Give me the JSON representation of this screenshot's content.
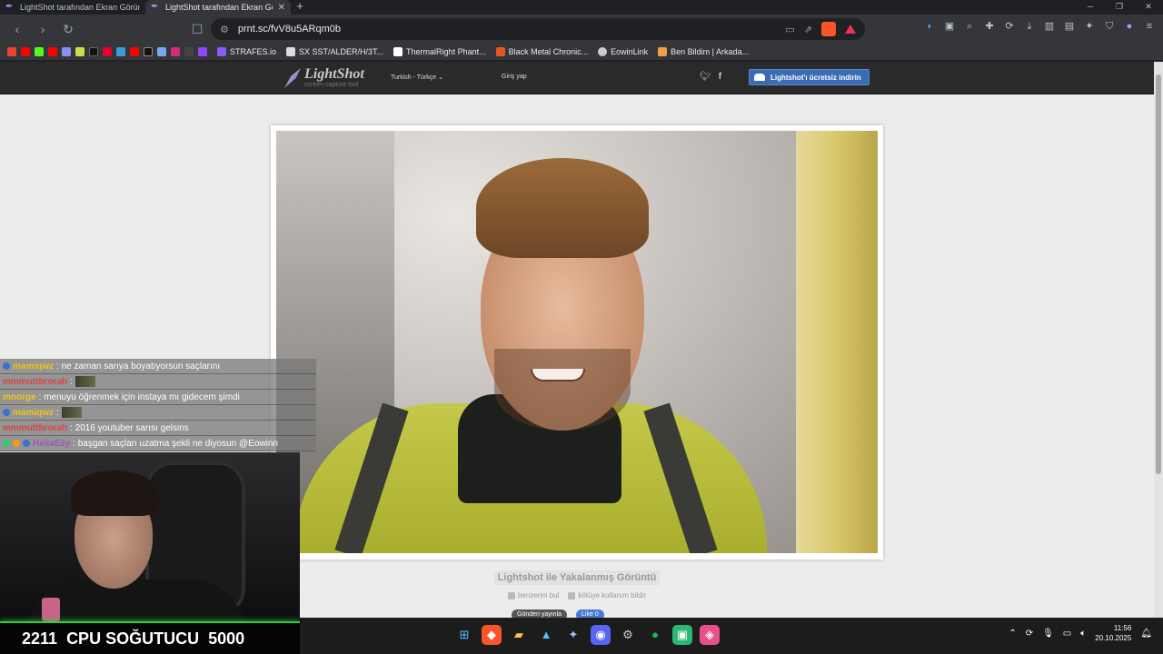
{
  "browser": {
    "tabs": [
      {
        "title": "LightShot tarafından Ekran Görüntü",
        "active": false
      },
      {
        "title": "LightShot tarafından Ekran Görün",
        "active": true
      }
    ],
    "new_tab": "+",
    "url": "prnt.sc/fvV8u5ARqm0b",
    "bookmarks": [
      {
        "label": "STRAFES.io",
        "color": "#8a5cf6"
      },
      {
        "label": "SX SST/ALDER/H/3T...",
        "color": "#dddddd"
      },
      {
        "label": "ThermalRight Phant...",
        "color": "#ffffff"
      },
      {
        "label": "Black Metal Chronic...",
        "color": "#e25822"
      },
      {
        "label": "EowinLink",
        "color": "#cccccc"
      },
      {
        "label": "Ben Bildim | Arkada...",
        "color": "#f0a04b"
      }
    ]
  },
  "lightshot": {
    "logo_title": "LightShot",
    "logo_subtitle": "screen capture tool",
    "language": "Turkish - Türkçe",
    "login": "Giriş yap",
    "download": "Lightshot'ı ücretsiz indirin",
    "caption": "Lightshot ile Yakalanmış Görüntü",
    "find_similar": "benzerini bul",
    "report": "kötüye kullanım bildir",
    "share_x": "Gönderi yayınla",
    "share_like": "Like 0"
  },
  "chat": [
    {
      "user": "mamiqwz",
      "user_color": "#f0c419",
      "text": ": ne zaman sarıya boyatıyorsun saçlarını",
      "emote": false
    },
    {
      "user": "mmmuttbrorah",
      "user_color": "#d64545",
      "text": ":",
      "emote": true
    },
    {
      "user": "moorge",
      "user_color": "#f0c419",
      "text": ": menuyu öğrenmek için instaya mı gidecem şimdi",
      "emote": false
    },
    {
      "user": "mamiqwz",
      "user_color": "#f0c419",
      "text": ":",
      "emote": true
    },
    {
      "user": "mmmuttbrorah",
      "user_color": "#d64545",
      "text": ": 2016 youtuber sarısı gelsins",
      "emote": false
    },
    {
      "user": "HelixEzy",
      "user_color": "#9b59b6",
      "text": ": başgan saçları uzatma şekli ne diyosun @Eowinn",
      "emote": false
    }
  ],
  "stream_bar": {
    "count": "2211",
    "label": "CPU SOĞUTUCU",
    "price": "5000"
  },
  "taskbar": {
    "time": "11:56",
    "date": "20.10.2025"
  }
}
